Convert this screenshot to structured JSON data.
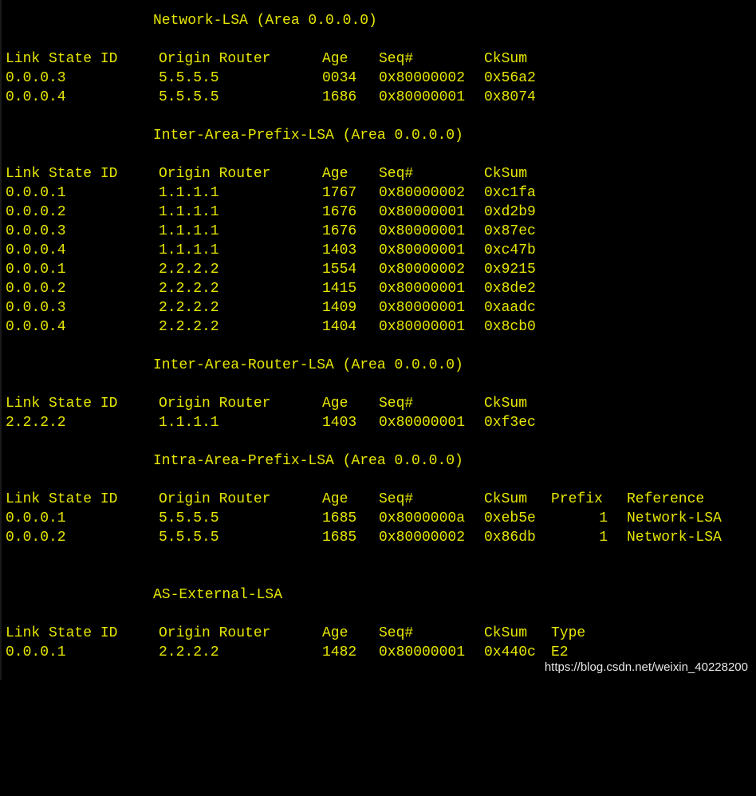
{
  "colors": {
    "background": "#000000",
    "text": "#e6e600",
    "watermark": "#e8e8e8"
  },
  "sections": [
    {
      "title": "Network-LSA (Area 0.0.0.0)",
      "headers": [
        "Link State ID",
        "Origin Router",
        "Age",
        "Seq#",
        "CkSum"
      ],
      "rows": [
        [
          "0.0.0.3",
          "5.5.5.5",
          "0034",
          "0x80000002",
          "0x56a2"
        ],
        [
          "0.0.0.4",
          "5.5.5.5",
          "1686",
          "0x80000001",
          "0x8074"
        ]
      ]
    },
    {
      "title": "Inter-Area-Prefix-LSA (Area 0.0.0.0)",
      "headers": [
        "Link State ID",
        "Origin Router",
        "Age",
        "Seq#",
        "CkSum"
      ],
      "rows": [
        [
          "0.0.0.1",
          "1.1.1.1",
          "1767",
          "0x80000002",
          "0xc1fa"
        ],
        [
          "0.0.0.2",
          "1.1.1.1",
          "1676",
          "0x80000001",
          "0xd2b9"
        ],
        [
          "0.0.0.3",
          "1.1.1.1",
          "1676",
          "0x80000001",
          "0x87ec"
        ],
        [
          "0.0.0.4",
          "1.1.1.1",
          "1403",
          "0x80000001",
          "0xc47b"
        ],
        [
          "0.0.0.1",
          "2.2.2.2",
          "1554",
          "0x80000002",
          "0x9215"
        ],
        [
          "0.0.0.2",
          "2.2.2.2",
          "1415",
          "0x80000001",
          "0x8de2"
        ],
        [
          "0.0.0.3",
          "2.2.2.2",
          "1409",
          "0x80000001",
          "0xaadc"
        ],
        [
          "0.0.0.4",
          "2.2.2.2",
          "1404",
          "0x80000001",
          "0x8cb0"
        ]
      ]
    },
    {
      "title": "Inter-Area-Router-LSA (Area 0.0.0.0)",
      "headers": [
        "Link State ID",
        "Origin Router",
        "Age",
        "Seq#",
        "CkSum"
      ],
      "rows": [
        [
          "2.2.2.2",
          "1.1.1.1",
          "1403",
          "0x80000001",
          "0xf3ec"
        ]
      ]
    },
    {
      "title": "Intra-Area-Prefix-LSA (Area 0.0.0.0)",
      "headers": [
        "Link State ID",
        "Origin Router",
        "Age",
        "Seq#",
        "CkSum",
        "Prefix",
        "Reference"
      ],
      "rows": [
        [
          "0.0.0.1",
          "5.5.5.5",
          "1685",
          "0x8000000a",
          "0xeb5e",
          "1",
          "Network-LSA"
        ],
        [
          "0.0.0.2",
          "5.5.5.5",
          "1685",
          "0x80000002",
          "0x86db",
          "1",
          "Network-LSA"
        ]
      ]
    },
    {
      "title": "AS-External-LSA",
      "headers": [
        "Link State ID",
        "Origin Router",
        "Age",
        "Seq#",
        "CkSum",
        "Type"
      ],
      "rows": [
        [
          "0.0.0.1",
          "2.2.2.2",
          "1482",
          "0x80000001",
          "0x440c",
          "E2"
        ]
      ]
    }
  ],
  "watermark": "https://blog.csdn.net/weixin_40228200"
}
